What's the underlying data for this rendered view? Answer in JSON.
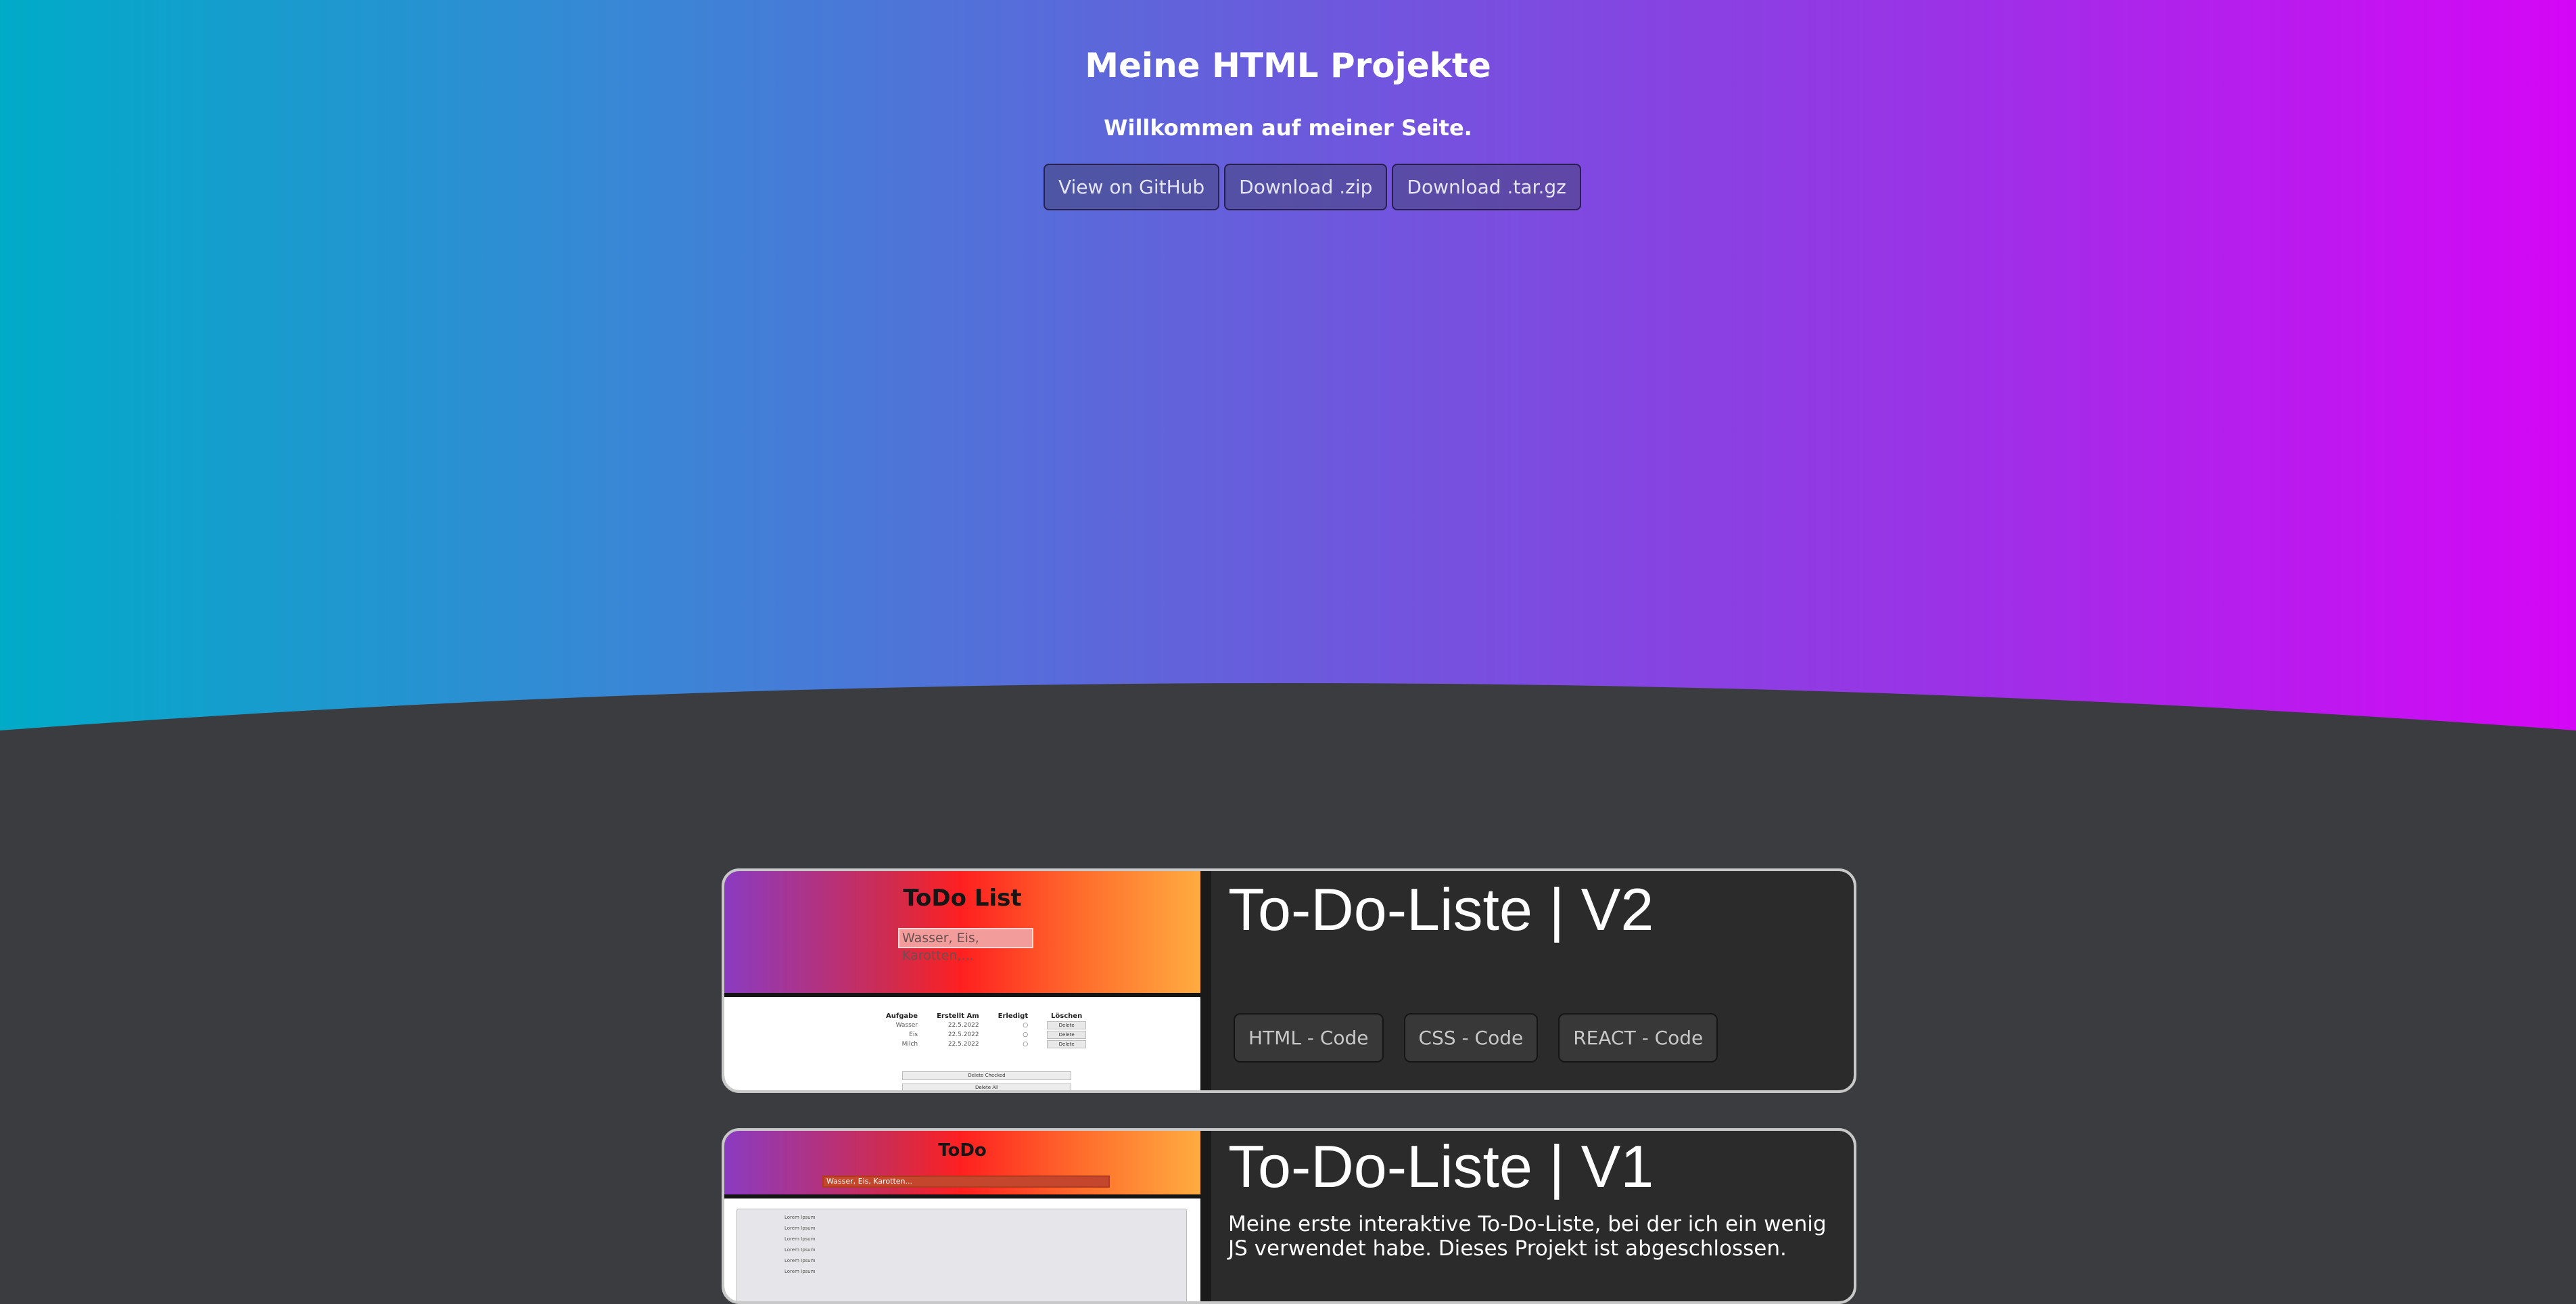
{
  "header": {
    "title": "Meine HTML Projekte",
    "subtitle": "Willkommen auf meiner Seite.",
    "buttons": [
      "View on GitHub",
      "Download .zip",
      "Download .tar.gz"
    ]
  },
  "colors": {
    "hero_gradient": [
      "#00abc8",
      "#d506f6"
    ],
    "page_background": "#3a3c3f",
    "card_background": "#2b2b2b",
    "card_border": "#c8c8c8"
  },
  "projects": [
    {
      "title": "To-Do-Liste | V2",
      "code_buttons": [
        "HTML - Code",
        "CSS - Code",
        "REACT - Code"
      ],
      "thumbnail": {
        "title": "ToDo List",
        "input_placeholder": "Wasser, Eis, Karotten,...",
        "table_headers": [
          "Aufgabe",
          "Erstellt Am",
          "Erledigt",
          "Löschen"
        ],
        "table_rows": [
          {
            "task": "Wasser",
            "date": "22.5.2022",
            "action": "Delete"
          },
          {
            "task": "Eis",
            "date": "22.5.2022",
            "action": "Delete"
          },
          {
            "task": "Milch",
            "date": "22.5.2022",
            "action": "Delete"
          }
        ],
        "footer_buttons": [
          "Delete Checked",
          "Delete All"
        ]
      }
    },
    {
      "title": "To-Do-Liste | V1",
      "description": "Meine erste interaktive To-Do-Liste, bei der ich ein wenig JS verwendet habe. Dieses Projekt ist abgeschlossen.",
      "thumbnail": {
        "title": "ToDo",
        "input_placeholder": "Wasser, Eis, Karotten...",
        "list_items": [
          "Lorem Ipsum",
          "Lorem Ipsum",
          "Lorem Ipsum",
          "Lorem Ipsum",
          "Lorem Ipsum",
          "Lorem Ipsum"
        ]
      }
    }
  ]
}
